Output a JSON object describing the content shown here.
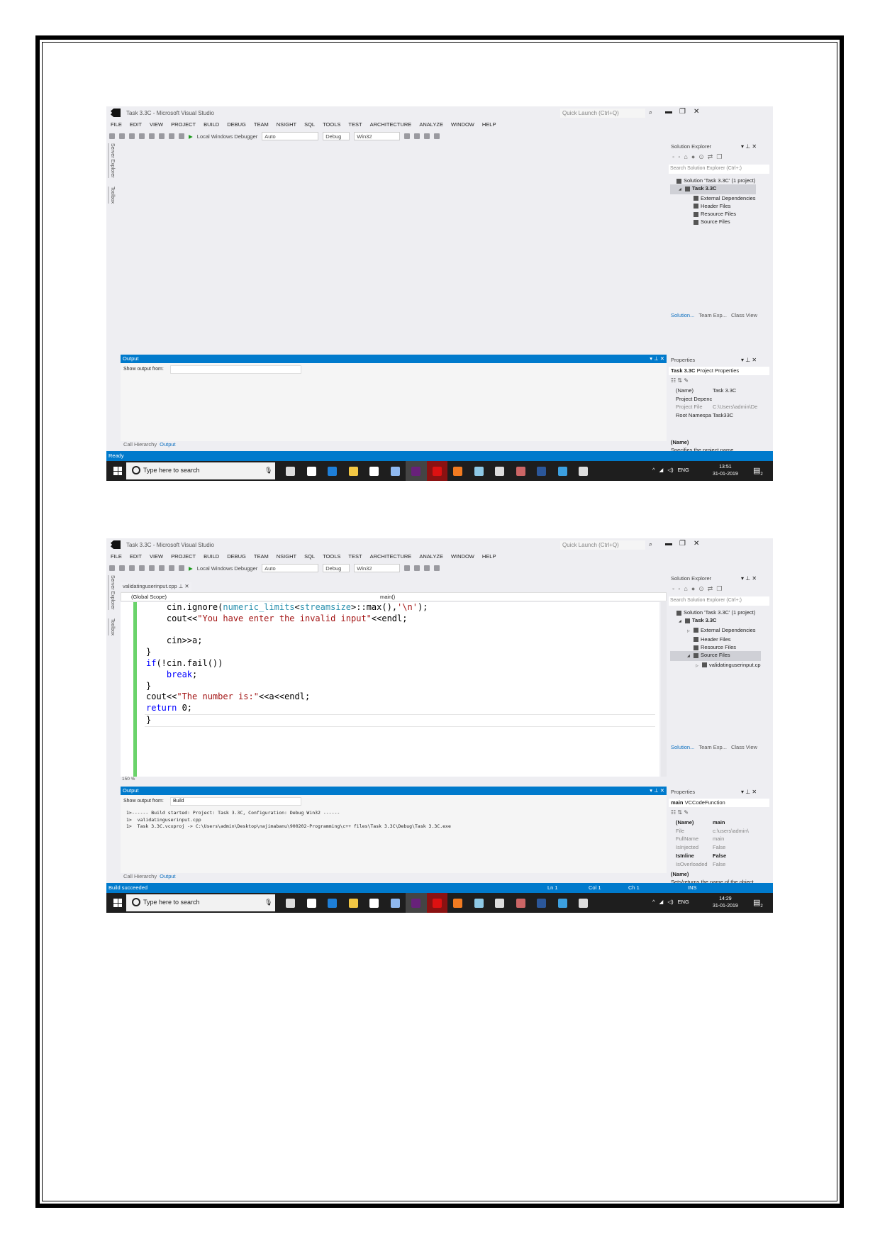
{
  "windows": [
    {
      "title": "Task 3.3C - Microsoft Visual Studio",
      "quick_launch_placeholder": "Quick Launch (Ctrl+Q)",
      "menu": [
        "FILE",
        "EDIT",
        "VIEW",
        "PROJECT",
        "BUILD",
        "DEBUG",
        "TEAM",
        "NSIGHT",
        "SQL",
        "TOOLS",
        "TEST",
        "ARCHITECTURE",
        "ANALYZE",
        "WINDOW",
        "HELP"
      ],
      "toolbar": {
        "debugger": "Local Windows Debugger",
        "solution_config_auto": "Auto",
        "config": "Debug",
        "platform": "Win32"
      },
      "left_tabs": [
        "Server Explorer",
        "Toolbox"
      ],
      "editor": null,
      "output": {
        "title": "Output",
        "show_from_label": "Show output from:",
        "show_from_value": "",
        "lines": []
      },
      "bottom_tabs": [
        "Call Hierarchy",
        "Output"
      ],
      "status": {
        "text": "Ready",
        "ln": "",
        "col": "",
        "ch": "",
        "mode": ""
      },
      "taskbar": {
        "search_placeholder": "Type here to search",
        "language": "ENG",
        "time": "13:51",
        "date": "31-01-2019",
        "notifications": "2"
      },
      "solution_explorer": {
        "title": "Solution Explorer",
        "search_placeholder": "Search Solution Explorer (Ctrl+;)",
        "tree": [
          {
            "label": "Solution 'Task 3.3C' (1 project)",
            "level": 0,
            "bold": false,
            "selected": false,
            "arrow": ""
          },
          {
            "label": "Task 3.3C",
            "level": 1,
            "bold": true,
            "selected": true,
            "arrow": "◢"
          },
          {
            "label": "External Dependencies",
            "level": 2,
            "bold": false,
            "selected": false,
            "arrow": ""
          },
          {
            "label": "Header Files",
            "level": 2,
            "bold": false,
            "selected": false,
            "arrow": ""
          },
          {
            "label": "Resource Files",
            "level": 2,
            "bold": false,
            "selected": false,
            "arrow": ""
          },
          {
            "label": "Source Files",
            "level": 2,
            "bold": false,
            "selected": false,
            "arrow": ""
          }
        ],
        "tabs": [
          "Solution...",
          "Team Exp...",
          "Class View"
        ]
      },
      "properties": {
        "title": "Properties",
        "object": "Task 3.3C",
        "object_type": "Project Properties",
        "rows": [
          {
            "name": "(Name)",
            "value": "Task 3.3C",
            "style": ""
          },
          {
            "name": "Project Depenc",
            "value": "",
            "style": ""
          },
          {
            "name": "Project File",
            "value": "C:\\Users\\admin\\De",
            "style": "dim"
          },
          {
            "name": "Root Namespa",
            "value": "Task33C",
            "style": ""
          }
        ],
        "desc_title": "(Name)",
        "desc_text": "Specifies the project name."
      }
    },
    {
      "title": "Task 3.3C - Microsoft Visual Studio",
      "quick_launch_placeholder": "Quick Launch (Ctrl+Q)",
      "menu": [
        "FILE",
        "EDIT",
        "VIEW",
        "PROJECT",
        "BUILD",
        "DEBUG",
        "TEAM",
        "NSIGHT",
        "SQL",
        "TOOLS",
        "TEST",
        "ARCHITECTURE",
        "ANALYZE",
        "WINDOW",
        "HELP"
      ],
      "toolbar": {
        "debugger": "Local Windows Debugger",
        "solution_config_auto": "Auto",
        "config": "Debug",
        "platform": "Win32"
      },
      "left_tabs": [
        "Server Explorer",
        "Toolbox"
      ],
      "editor": {
        "tab": "validatinguserinput.cpp",
        "scope": "(Global Scope)",
        "member": "main()",
        "zoom": "150 %",
        "code": [
          [
            [
              "    cin.ignore(",
              "pl"
            ],
            [
              "numeric_limits",
              "type"
            ],
            [
              "<",
              "pl"
            ],
            [
              "streamsize",
              "type"
            ],
            [
              ">::max(),",
              "pl"
            ],
            [
              "'\\n'",
              "str"
            ],
            [
              ");",
              "pl"
            ]
          ],
          [
            [
              "    cout<<",
              "pl"
            ],
            [
              "\"You have enter the invalid input\"",
              "str"
            ],
            [
              "<<endl;",
              "pl"
            ]
          ],
          [
            [
              "",
              "pl"
            ]
          ],
          [
            [
              "    cin>>a;",
              "pl"
            ]
          ],
          [
            [
              "}",
              "pl"
            ]
          ],
          [
            [
              "if",
              "kw"
            ],
            [
              "(!cin.fail())",
              "pl"
            ]
          ],
          [
            [
              "    ",
              "pl"
            ],
            [
              "break",
              "kw"
            ],
            [
              ";",
              "pl"
            ]
          ],
          [
            [
              "}",
              "pl"
            ]
          ],
          [
            [
              "cout<<",
              "pl"
            ],
            [
              "\"The number is:\"",
              "str"
            ],
            [
              "<<a<<endl;",
              "pl"
            ]
          ],
          [
            [
              "return",
              "kw"
            ],
            [
              " 0;",
              "pl"
            ]
          ],
          [
            [
              "}",
              "pl"
            ]
          ]
        ]
      },
      "output": {
        "title": "Output",
        "show_from_label": "Show output from:",
        "show_from_value": "Build",
        "lines": [
          "1>------ Build started: Project: Task 3.3C, Configuration: Debug Win32 ------",
          "1>  validatinguserinput.cpp",
          "1>  Task 3.3C.vcxproj -> C:\\Users\\admin\\Desktop\\najimabanu\\900202-Programming\\c++ files\\Task 3.3C\\Debug\\Task 3.3C.exe"
        ]
      },
      "bottom_tabs": [
        "Call Hierarchy",
        "Output"
      ],
      "status": {
        "text": "Build succeeded",
        "ln": "Ln 1",
        "col": "Col 1",
        "ch": "Ch 1",
        "mode": "INS"
      },
      "taskbar": {
        "search_placeholder": "Type here to search",
        "language": "ENG",
        "time": "14:29",
        "date": "31-01-2019",
        "notifications": "2"
      },
      "solution_explorer": {
        "title": "Solution Explorer",
        "search_placeholder": "Search Solution Explorer (Ctrl+;)",
        "tree": [
          {
            "label": "Solution 'Task 3.3C' (1 project)",
            "level": 0,
            "bold": false,
            "selected": false,
            "arrow": ""
          },
          {
            "label": "Task 3.3C",
            "level": 1,
            "bold": true,
            "selected": false,
            "arrow": "◢"
          },
          {
            "label": "External Dependencies",
            "level": 2,
            "bold": false,
            "selected": false,
            "arrow": "▷"
          },
          {
            "label": "Header Files",
            "level": 2,
            "bold": false,
            "selected": false,
            "arrow": ""
          },
          {
            "label": "Resource Files",
            "level": 2,
            "bold": false,
            "selected": false,
            "arrow": ""
          },
          {
            "label": "Source Files",
            "level": 2,
            "bold": false,
            "selected": true,
            "arrow": "◢"
          },
          {
            "label": "validatinguserinput.cp",
            "level": 3,
            "bold": false,
            "selected": false,
            "arrow": "▷"
          }
        ],
        "tabs": [
          "Solution...",
          "Team Exp...",
          "Class View"
        ]
      },
      "properties": {
        "title": "Properties",
        "object": "main",
        "object_type": "VCCodeFunction",
        "rows": [
          {
            "name": "(Name)",
            "value": "main",
            "style": "bold"
          },
          {
            "name": "File",
            "value": "c:\\users\\admin\\",
            "style": "dim"
          },
          {
            "name": "FullName",
            "value": "main",
            "style": "dim"
          },
          {
            "name": "IsInjected",
            "value": "False",
            "style": "dim"
          },
          {
            "name": "IsInline",
            "value": "False",
            "style": "bold"
          },
          {
            "name": "IsOverloaded",
            "value": "False",
            "style": "dim"
          }
        ],
        "desc_title": "(Name)",
        "desc_text": "Sets/returns the name of the object."
      }
    }
  ],
  "colors": {
    "accent": "#007acc",
    "taskbar": "#1e1e1e",
    "ide_bg": "#eeeef2",
    "changed_line": "#6ad36a"
  },
  "taskbar_icons": [
    "task-view",
    "mail",
    "edge",
    "file-explorer",
    "store",
    "dropbox",
    "visual-studio",
    "opera",
    "sublime",
    "notes",
    "calculator",
    "paint",
    "word",
    "help",
    "people"
  ]
}
